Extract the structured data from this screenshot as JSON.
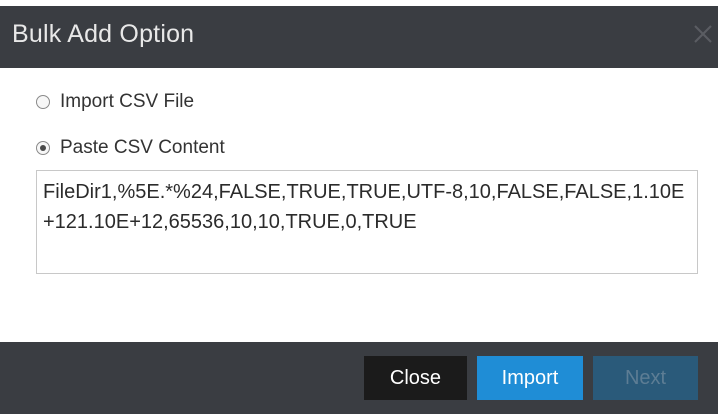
{
  "dialog": {
    "title": "Bulk Add Option"
  },
  "options": {
    "import_csv_label": "Import CSV File",
    "paste_csv_label": "Paste CSV Content",
    "selected": "paste_csv"
  },
  "csv_content": {
    "value": "FileDir1,%5E.*%24,FALSE,TRUE,TRUE,UTF-8,10,FALSE,FALSE,1.10E+121.10E+12,65536,10,10,TRUE,0,TRUE"
  },
  "footer": {
    "close_label": "Close",
    "import_label": "Import",
    "next_label": "Next",
    "next_disabled": true
  },
  "colors": {
    "titlebar": "#3a3d42",
    "primary_button": "#1f8dd6",
    "close_button": "#1b1b1b",
    "disabled_button": "#2a5a7a"
  },
  "icons": {
    "close": "close-icon",
    "radio_unchecked": "radio-unchecked",
    "radio_checked": "radio-checked"
  }
}
